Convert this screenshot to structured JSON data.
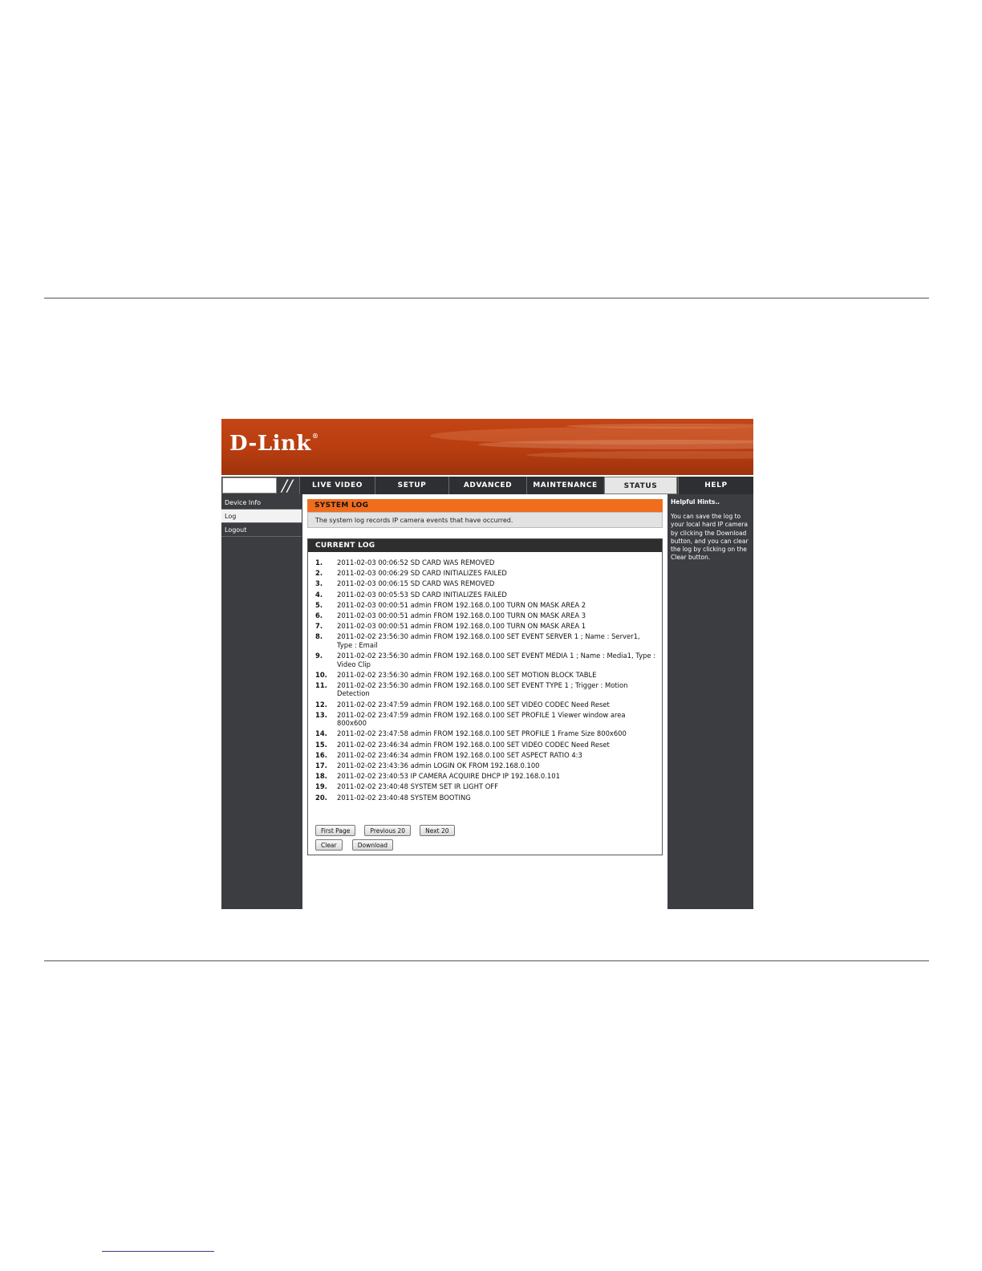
{
  "brand": {
    "logo_text": "D-Link",
    "reg_mark": "®"
  },
  "nav": {
    "slashes": "//",
    "tabs": [
      {
        "label": "LIVE VIDEO"
      },
      {
        "label": "SETUP"
      },
      {
        "label": "ADVANCED"
      },
      {
        "label": "MAINTENANCE"
      },
      {
        "label": "STATUS"
      },
      {
        "label": "HELP"
      }
    ],
    "active_tab": "STATUS"
  },
  "sidebar": {
    "items": [
      {
        "label": "Device Info"
      },
      {
        "label": "Log"
      },
      {
        "label": "Logout"
      }
    ],
    "active_item": "Log"
  },
  "system_log": {
    "title": "SYSTEM LOG",
    "description": "The system log records IP camera events that have occurred."
  },
  "current_log": {
    "title": "CURRENT LOG",
    "entries": [
      {
        "num": "1.",
        "text": "2011-02-03 00:06:52 SD CARD WAS REMOVED"
      },
      {
        "num": "2.",
        "text": "2011-02-03 00:06:29 SD CARD INITIALIZES FAILED"
      },
      {
        "num": "3.",
        "text": "2011-02-03 00:06:15 SD CARD WAS REMOVED"
      },
      {
        "num": "4.",
        "text": "2011-02-03 00:05:53 SD CARD INITIALIZES FAILED"
      },
      {
        "num": "5.",
        "text": "2011-02-03 00:00:51 admin FROM 192.168.0.100 TURN ON MASK AREA 2"
      },
      {
        "num": "6.",
        "text": "2011-02-03 00:00:51 admin FROM 192.168.0.100 TURN ON MASK AREA 3"
      },
      {
        "num": "7.",
        "text": "2011-02-03 00:00:51 admin FROM 192.168.0.100 TURN ON MASK AREA 1"
      },
      {
        "num": "8.",
        "text": "2011-02-02 23:56:30 admin FROM 192.168.0.100 SET EVENT SERVER 1 ; Name : Server1, Type : Email"
      },
      {
        "num": "9.",
        "text": "2011-02-02 23:56:30 admin FROM 192.168.0.100 SET EVENT MEDIA 1 ; Name : Media1, Type : Video Clip"
      },
      {
        "num": "10.",
        "text": "2011-02-02 23:56:30 admin FROM 192.168.0.100 SET MOTION BLOCK TABLE"
      },
      {
        "num": "11.",
        "text": "2011-02-02 23:56:30 admin FROM 192.168.0.100 SET EVENT TYPE 1 ; Trigger : Motion Detection"
      },
      {
        "num": "12.",
        "text": "2011-02-02 23:47:59 admin FROM 192.168.0.100 SET VIDEO CODEC Need Reset"
      },
      {
        "num": "13.",
        "text": "2011-02-02 23:47:59 admin FROM 192.168.0.100 SET PROFILE 1 Viewer window area 800x600"
      },
      {
        "num": "14.",
        "text": "2011-02-02 23:47:58 admin FROM 192.168.0.100 SET PROFILE 1 Frame Size 800x600"
      },
      {
        "num": "15.",
        "text": "2011-02-02 23:46:34 admin FROM 192.168.0.100 SET VIDEO CODEC Need Reset"
      },
      {
        "num": "16.",
        "text": "2011-02-02 23:46:34 admin FROM 192.168.0.100 SET ASPECT RATIO 4:3"
      },
      {
        "num": "17.",
        "text": "2011-02-02 23:43:36 admin LOGIN OK FROM 192.168.0.100"
      },
      {
        "num": "18.",
        "text": "2011-02-02 23:40:53 IP CAMERA ACQUIRE DHCP IP 192.168.0.101"
      },
      {
        "num": "19.",
        "text": "2011-02-02 23:40:48 SYSTEM SET IR LIGHT OFF"
      },
      {
        "num": "20.",
        "text": "2011-02-02 23:40:48 SYSTEM BOOTING"
      }
    ]
  },
  "buttons": {
    "first_page": "First Page",
    "previous": "Previous 20",
    "next": "Next 20",
    "clear": "Clear",
    "download": "Download"
  },
  "hints": {
    "title": "Helpful Hints..",
    "text": "You can save the log to your local hard IP camera by clicking the Download button, and you can clear the log by clicking on the Clear button."
  },
  "colors": {
    "banner_orange": "#b83d10",
    "section_orange": "#f06d1e",
    "dark_panel": "#3b3d40"
  }
}
